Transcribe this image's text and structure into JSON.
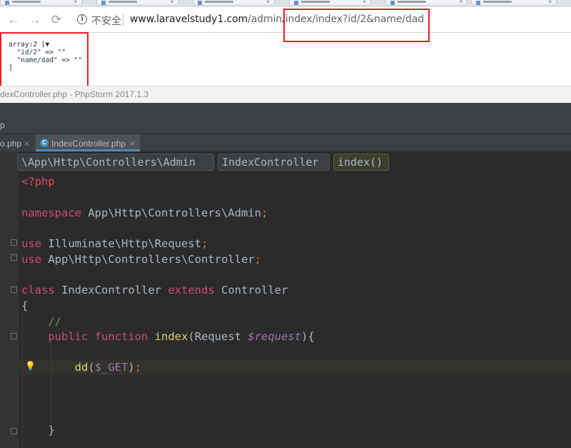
{
  "browser": {
    "security_label": "不安全",
    "url_host": "www.laravelstudy1.com",
    "url_path": "/admin/index/index?id/2&name/dad"
  },
  "dump": {
    "header": "array:2 [▼",
    "line1_key": "\"id/2\"",
    "line1_arrow": " => ",
    "line1_val": "\"\"",
    "line2_key": "\"name/dad\"",
    "line2_arrow": " => ",
    "line2_val": "\"\"",
    "close": "]"
  },
  "ide": {
    "window_title": "dexController.php - PhpStorm 2017.1.3",
    "crumb_left": "p",
    "tabs": [
      {
        "label": "o.php",
        "close": "×"
      },
      {
        "label": "IndexController.php",
        "close": "×",
        "icon": "C"
      }
    ],
    "breadcrumbs": [
      "\\App\\Http\\Controllers\\Admin",
      "IndexController",
      "index()"
    ],
    "code": {
      "php_open": "<?php",
      "namespace_kw": "namespace",
      "namespace_val": "App\\Http\\Controllers\\Admin",
      "semi": ";",
      "use_kw": "use",
      "use1": "Illuminate\\Http\\Request",
      "use2": "App\\Http\\Controllers\\Controller",
      "class_kw": "class",
      "class_name": "IndexController",
      "extends_kw": "extends",
      "parent": "Controller",
      "brace_open": "{",
      "comment": "//",
      "public_kw": "public",
      "function_kw": "function",
      "fn_name": "index",
      "param_type": "Request",
      "param_var": "$request",
      "fn_tail": "){",
      "dd_name": "dd",
      "dd_arg": "$_GET",
      "dd_tail": ")",
      "brace_close": "}"
    }
  },
  "colors": {
    "highlight_box": "#ee1c25",
    "editor_bg": "#2b2b2b",
    "keyword": "#cc4a7a"
  }
}
